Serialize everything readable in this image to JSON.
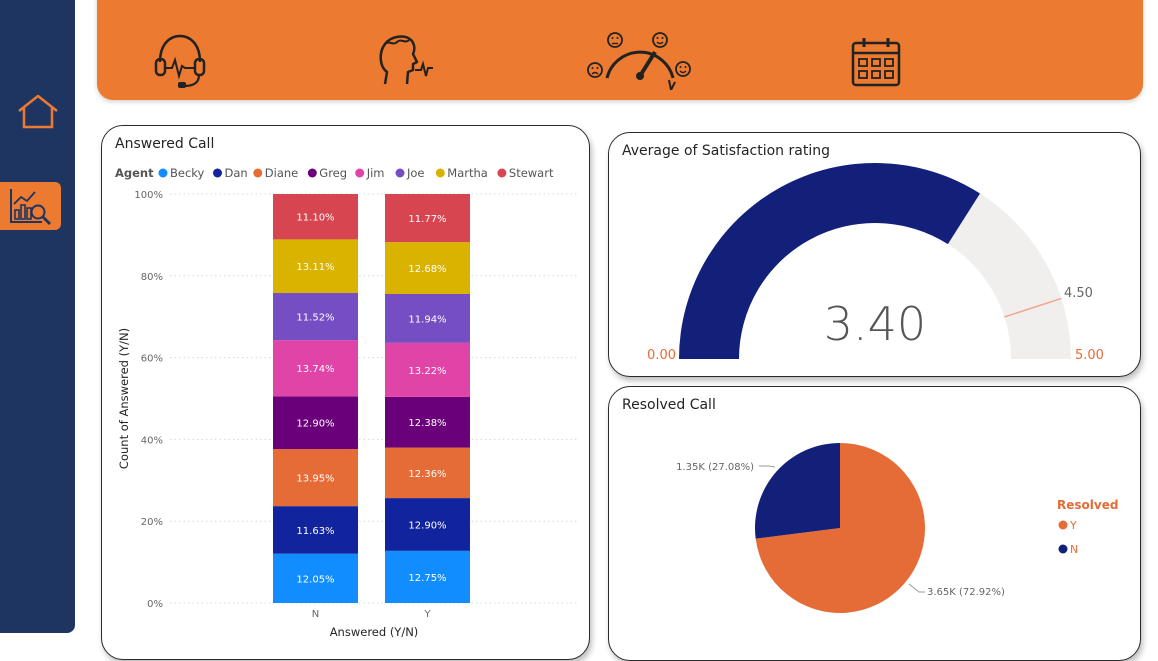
{
  "nav": {
    "items": [
      {
        "name": "home",
        "icon": "home-icon"
      },
      {
        "name": "analytics",
        "icon": "analytics-report-icon",
        "active": true
      }
    ]
  },
  "header": {
    "icons": [
      "headset-icon",
      "customer-head-icon",
      "satisfaction-gauge-icon",
      "calendar-icon"
    ]
  },
  "answered_call": {
    "title": "Answered Call",
    "legend_title": "Agent",
    "y_axis_label": "Count of Answered (Y/N)",
    "x_axis_label": "Answered (Y/N)",
    "y_ticks": [
      "100%",
      "80%",
      "60%",
      "40%",
      "20%",
      "0%"
    ]
  },
  "satisfaction": {
    "title": "Average of Satisfaction rating",
    "value_label": "3.40",
    "min_label": "0.00",
    "max_label": "5.00",
    "target_label": "4.50"
  },
  "resolved": {
    "title": "Resolved Call",
    "legend_title": "Resolved"
  },
  "colors": {
    "accent": "#ec7a31",
    "sidebar": "#1e3461",
    "gauge_fill": "#12207a",
    "gauge_track": "#f0efee",
    "target_line": "#f2a58c"
  },
  "chart_data": [
    {
      "type": "bar",
      "stacked": "percent",
      "title": "Answered Call",
      "xlabel": "Answered (Y/N)",
      "ylabel": "Count of Answered (Y/N)",
      "categories": [
        "N",
        "Y"
      ],
      "ylim": [
        0,
        100
      ],
      "legend": "top",
      "series": [
        {
          "name": "Becky",
          "color": "#118dff",
          "values": [
            12.05,
            12.75
          ]
        },
        {
          "name": "Dan",
          "color": "#12239e",
          "values": [
            11.63,
            12.9
          ]
        },
        {
          "name": "Diane",
          "color": "#e66c37",
          "values": [
            13.95,
            12.36
          ]
        },
        {
          "name": "Greg",
          "color": "#6b007b",
          "values": [
            12.9,
            12.38
          ]
        },
        {
          "name": "Jim",
          "color": "#e044a7",
          "values": [
            13.74,
            13.22
          ]
        },
        {
          "name": "Joe",
          "color": "#744ec2",
          "values": [
            11.52,
            11.94
          ]
        },
        {
          "name": "Martha",
          "color": "#d9b300",
          "values": [
            13.11,
            12.68
          ]
        },
        {
          "name": "Stewart",
          "color": "#d64550",
          "values": [
            11.1,
            11.77
          ]
        }
      ],
      "data_labels": [
        [
          "12.05%",
          "11.63%",
          "13.95%",
          "12.90%",
          "13.74%",
          "11.52%",
          "13.11%",
          "11.10%"
        ],
        [
          "12.75%",
          "12.90%",
          "12.36%",
          "12.38%",
          "13.22%",
          "11.94%",
          "12.68%",
          "11.77%"
        ]
      ]
    },
    {
      "type": "gauge",
      "title": "Average of Satisfaction rating",
      "value": 3.4,
      "min": 0,
      "max": 5,
      "target": 4.5
    },
    {
      "type": "pie",
      "title": "Resolved Call",
      "legend_title": "Resolved",
      "legend": "right",
      "slices": [
        {
          "name": "Y",
          "value": 3650,
          "percent": 72.92,
          "label": "3.65K (72.92%)",
          "color": "#e66c37"
        },
        {
          "name": "N",
          "value": 1350,
          "percent": 27.08,
          "label": "1.35K (27.08%)",
          "color": "#12207a"
        }
      ]
    }
  ]
}
